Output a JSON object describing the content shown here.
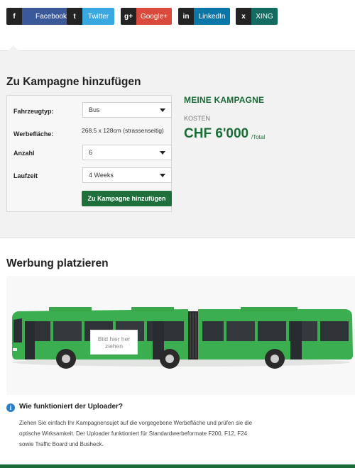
{
  "social": {
    "facebook": {
      "icon": "f",
      "label": "Facebook",
      "color": "#3b5998"
    },
    "twitter": {
      "icon": "t",
      "label": "Twitter",
      "color": "#3aa8e0"
    },
    "google": {
      "icon": "g+",
      "label": "Google+",
      "color": "#d9493c"
    },
    "linkedin": {
      "icon": "in",
      "label": "LinkedIn",
      "color": "#0b76a8"
    },
    "xing": {
      "icon": "x",
      "label": "XING",
      "color": "#136b61"
    }
  },
  "campaign": {
    "heading": "Zu Kampagne hinzufügen",
    "fields": {
      "fahrzeugtyp": {
        "label": "Fahrzeugtyp:",
        "value": "Bus"
      },
      "werbeflaeche": {
        "label": "Werbefläche:",
        "value": "268.5 x 128cm (strassenseitig)"
      },
      "anzahl": {
        "label": "Anzahl",
        "value": "6"
      },
      "laufzeit": {
        "label": "Laufzeit",
        "value": "4 Weeks"
      }
    },
    "add_button": "Zu Kampagne hinzufügen",
    "summary": {
      "title": "MEINE KAMPAGNE",
      "kosten_label": "KOSTEN",
      "price": "CHF 6'000",
      "price_suffix": "/Total"
    }
  },
  "placement": {
    "heading": "Werbung platzieren",
    "drop_zone": "Bild hier her ziehen",
    "info": {
      "heading": "Wie funktioniert der Uploader?",
      "text": "Ziehen Sie einfach Ihr Kampagnensujet auf die vorgegebene Werbefläche und prüfen sie die optische Wirksamkeit. Der Uploader funktioniert für Standardwerbeformate F200, F12, F24 sowie Traffic Board und Busheck."
    }
  },
  "colors": {
    "brand_green": "#1a6b36",
    "bus_green": "#3bae4f"
  }
}
